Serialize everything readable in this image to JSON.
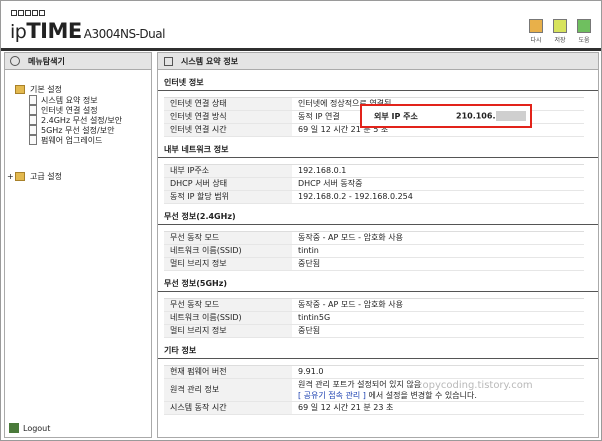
{
  "header": {
    "logo_prefix": "ip",
    "logo_main": "TIME",
    "model": "A3004NS-Dual",
    "icons": [
      {
        "name": "refresh-icon",
        "label": "다시"
      },
      {
        "name": "save-icon",
        "label": "저장"
      },
      {
        "name": "help-icon",
        "label": "도움"
      }
    ]
  },
  "sidebar": {
    "title": "메뉴탐색기",
    "basic_settings": "기본 설정",
    "basic_items": [
      "시스템 요약 정보",
      "인터넷 연결 설정",
      "2.4GHz 무선 설정/보안",
      "5GHz 무선 설정/보안",
      "펌웨어 업그레이드"
    ],
    "advanced_settings": "고급 설정",
    "logout": "Logout"
  },
  "main": {
    "title": "시스템 요약 정보",
    "sections": [
      {
        "title": "인터넷 정보",
        "rows": [
          {
            "k": "인터넷 연결 상태",
            "v": "인터넷에 정상적으로 연결됨"
          },
          {
            "k": "인터넷 연결 방식",
            "v": "동적 IP 연결"
          },
          {
            "k": "인터넷 연결 시간",
            "v": "69 일 12 시간 21 분 5 초"
          }
        ]
      },
      {
        "title": "내부 네트워크 정보",
        "rows": [
          {
            "k": "내부 IP주소",
            "v": "192.168.0.1"
          },
          {
            "k": "DHCP 서버 상태",
            "v": "DHCP 서버 동작중"
          },
          {
            "k": "동적 IP 할당 범위",
            "v": "192.168.0.2 - 192.168.0.254"
          }
        ]
      },
      {
        "title": "무선 정보(2.4GHz)",
        "rows": [
          {
            "k": "무선 동작 모드",
            "v": "동작중 - AP 모드 - 암호화 사용"
          },
          {
            "k": "네트워크 이름(SSID)",
            "v": "tintin"
          },
          {
            "k": "멀티 브리지 정보",
            "v": "중단됨"
          }
        ]
      },
      {
        "title": "무선 정보(5GHz)",
        "rows": [
          {
            "k": "무선 동작 모드",
            "v": "동작중 - AP 모드 - 암호화 사용"
          },
          {
            "k": "네트워크 이름(SSID)",
            "v": "tintin5G"
          },
          {
            "k": "멀티 브리지 정보",
            "v": "중단됨"
          }
        ]
      }
    ],
    "etc": {
      "title": "기타 정보",
      "firmware_k": "현재 펌웨어 버전",
      "firmware_v": "9.91.0",
      "remote_k": "원격 관리 정보",
      "remote_v1": "원격 관리 포트가 설정되어 있지 않음",
      "remote_link": "[ 공유기 접속 관리 ]",
      "remote_v2": "에서 설정을 변경할 수 있습니다.",
      "uptime_k": "시스템 동작 시간",
      "uptime_v": "69 일 12 시간 21 분 23 초"
    },
    "callout": {
      "label": "외부 IP 주소",
      "value": "210.106."
    }
  },
  "watermark": "copycoding.tistory.com"
}
